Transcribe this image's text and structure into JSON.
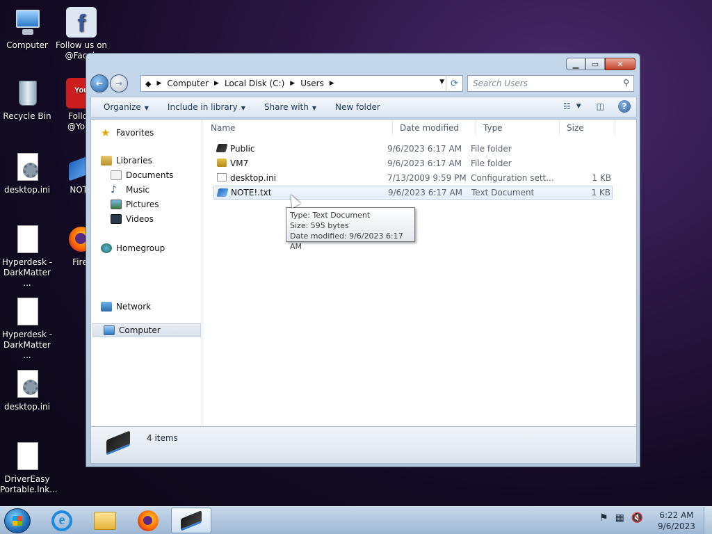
{
  "desktop_icons": [
    {
      "label": "Computer",
      "icon": "computer-icon"
    },
    {
      "label": "Follow us on @Faceb",
      "icon": "facebook-icon"
    },
    {
      "label": "Recycle Bin",
      "icon": "recycle-bin-icon"
    },
    {
      "label": "Follow @YouT",
      "icon": "youtube-icon"
    },
    {
      "label": "desktop.ini",
      "icon": "settings-file-icon"
    },
    {
      "label": "NOTE",
      "icon": "text-document-icon"
    },
    {
      "label": "Hyperdesk - DarkMatter ...",
      "icon": "blank-document-icon"
    },
    {
      "label": "Firef",
      "icon": "firefox-icon"
    },
    {
      "label": "Hyperdesk - DarkMatter ...",
      "icon": "blank-document-icon"
    },
    {
      "label": "desktop.ini",
      "icon": "settings-file-icon"
    },
    {
      "label": "DriverEasy Portable.lnk...",
      "icon": "blank-document-icon"
    }
  ],
  "window": {
    "caption_buttons": {
      "minimize": "▁",
      "maximize": "▭",
      "close": "✕"
    },
    "address": {
      "segments": [
        "Computer",
        "Local Disk (C:)",
        "Users"
      ],
      "separator": "▶"
    },
    "search_placeholder": "Search Users",
    "toolbar": {
      "organize": "Organize",
      "include_in_library": "Include in library",
      "share_with": "Share with",
      "new_folder": "New folder"
    },
    "nav_pane": {
      "favorites": "Favorites",
      "libraries": "Libraries",
      "documents": "Documents",
      "music": "Music",
      "pictures": "Pictures",
      "videos": "Videos",
      "homegroup": "Homegroup",
      "computer": "Computer",
      "network": "Network"
    },
    "columns": {
      "name": "Name",
      "date": "Date modified",
      "type": "Type",
      "size": "Size"
    },
    "files": [
      {
        "name": "Public",
        "date": "9/6/2023 6:17 AM",
        "type": "File folder",
        "size": ""
      },
      {
        "name": "VM7",
        "date": "9/6/2023 6:17 AM",
        "type": "File folder",
        "size": ""
      },
      {
        "name": "desktop.ini",
        "date": "7/13/2009 9:59 PM",
        "type": "Configuration sett...",
        "size": "1 KB"
      },
      {
        "name": "NOTE!.txt",
        "date": "9/6/2023 6:17 AM",
        "type": "Text Document",
        "size": "1 KB"
      }
    ],
    "tooltip": {
      "line1": "Type: Text Document",
      "line2": "Size: 595 bytes",
      "line3": "Date modified: 9/6/2023 6:17 AM"
    },
    "status": {
      "item_count": "4 items"
    }
  },
  "taskbar": {
    "clock_time": "6:22 AM",
    "clock_date": "9/6/2023",
    "apps": [
      "internet-explorer-icon",
      "windows-explorer-icon",
      "firefox-icon",
      "drive-icon"
    ]
  }
}
